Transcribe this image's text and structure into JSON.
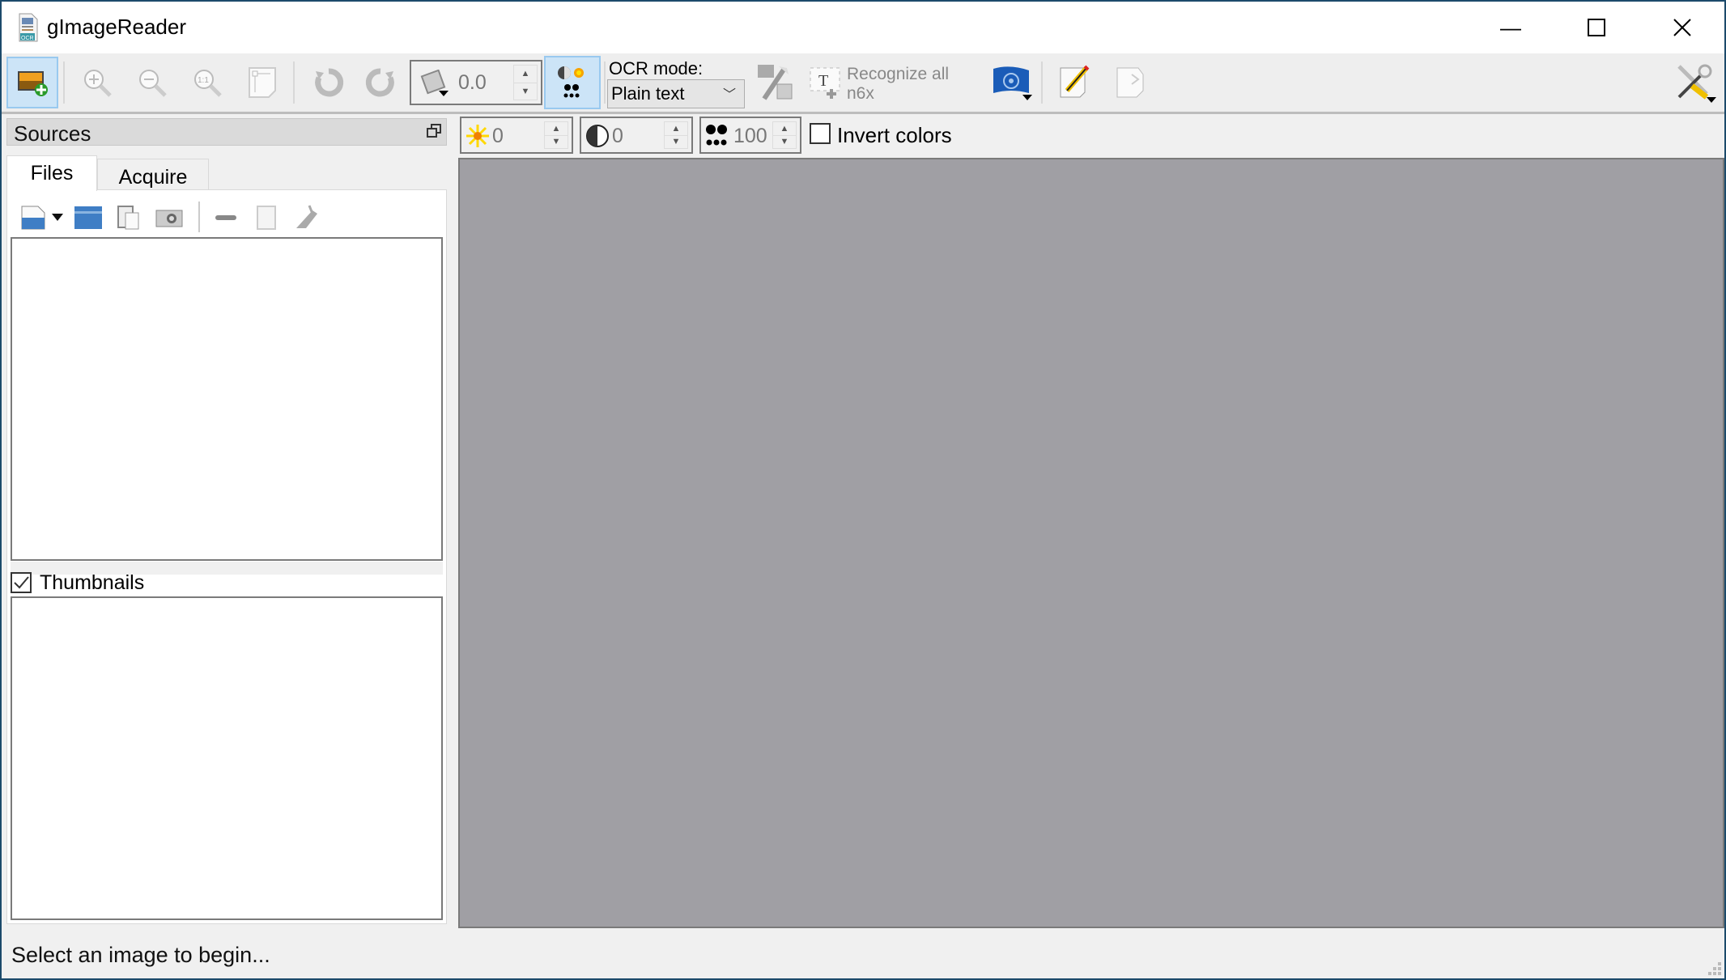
{
  "window": {
    "title": "gImageReader",
    "controls": {
      "minimize": "—",
      "maximize": "☐",
      "close": "✕"
    }
  },
  "toolbar": {
    "rotation_value": "0.0",
    "ocr_mode_label": "OCR mode:",
    "ocr_mode_value": "Plain text",
    "recognize_label_line1": "Recognize all",
    "recognize_label_line2": "n6x",
    "icons": [
      "add-image-icon",
      "zoom-in-icon",
      "zoom-out-icon",
      "zoom-original-icon",
      "best-fit-icon",
      "rotate-left-icon",
      "rotate-right-icon",
      "rotate-mode-icon",
      "image-controls-icon",
      "autodetect-layout-icon",
      "recognize-icon",
      "language-flag-icon",
      "output-edit-icon",
      "output-ocr-icon",
      "settings-icon"
    ]
  },
  "sources": {
    "title": "Sources",
    "tabs": [
      {
        "label": "Files",
        "selected": true
      },
      {
        "label": "Acquire",
        "selected": false
      }
    ],
    "file_toolbar_icons": [
      "open-file-icon",
      "dropdown-icon",
      "open-folder-icon",
      "paste-icon",
      "screenshot-icon",
      "remove-icon",
      "delete-icon",
      "clear-icon"
    ],
    "thumbnails_label": "Thumbnails",
    "thumbnails_checked": true
  },
  "image_controls": {
    "brightness": "0",
    "contrast": "0",
    "resolution": "100",
    "invert_label": "Invert colors",
    "invert_checked": false
  },
  "status": {
    "message": "Select an image to begin..."
  },
  "colors": {
    "canvas": "#a09fa4",
    "active_button": "#cce4f7",
    "toolbar": "#eeeeee"
  }
}
